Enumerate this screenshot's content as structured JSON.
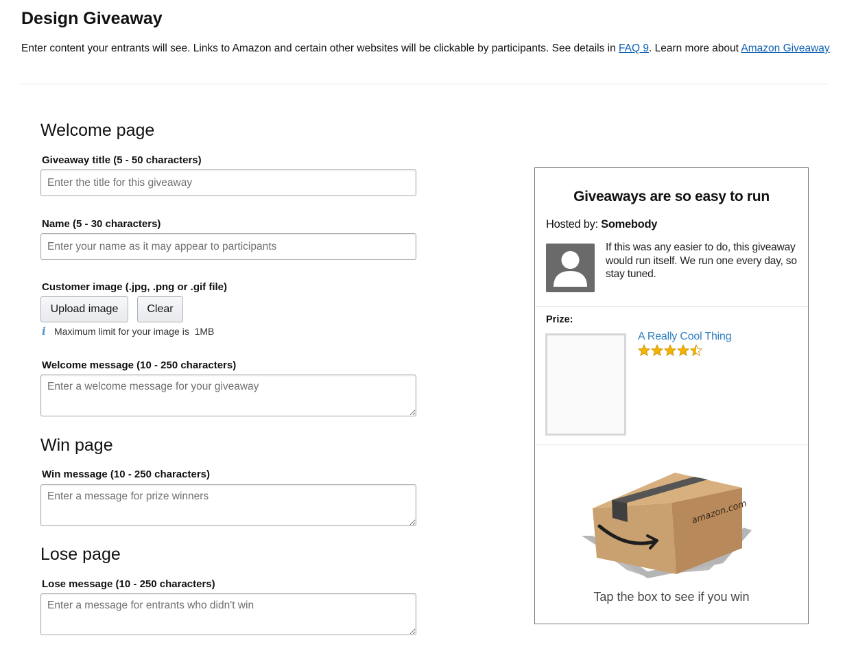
{
  "header": {
    "title": "Design Giveaway",
    "intro_text": "Enter content your entrants will see. Links to Amazon and certain other websites will be clickable by participants. See details in ",
    "faq_link": "FAQ 9",
    "intro_text_2": ". Learn more about ",
    "learn_link": "Amazon Giveaway"
  },
  "welcome_section": {
    "heading": "Welcome page",
    "title_field": {
      "label": "Giveaway title (5 - 50 characters)",
      "placeholder": "Enter the title for this giveaway",
      "value": ""
    },
    "name_field": {
      "label": "Name (5 - 30 characters)",
      "placeholder": "Enter your name as it may appear to participants",
      "value": ""
    },
    "image_field": {
      "label": "Customer image (.jpg, .png or .gif file)",
      "upload_button": "Upload image",
      "clear_button": "Clear",
      "hint": "Maximum limit for your image is  1MB"
    },
    "message_field": {
      "label": "Welcome message (10 - 250 characters)",
      "placeholder": "Enter a welcome message for your giveaway",
      "value": ""
    }
  },
  "win_section": {
    "heading": "Win page",
    "message_field": {
      "label": "Win message (10 - 250 characters)",
      "placeholder": "Enter a message for prize winners",
      "value": ""
    }
  },
  "lose_section": {
    "heading": "Lose page",
    "message_field": {
      "label": "Lose message (10 - 250 characters)",
      "placeholder": "Enter a message for entrants who didn't win",
      "value": ""
    }
  },
  "preview": {
    "title": "Giveaways are so easy to run",
    "hosted_label": "Hosted by: ",
    "host_name": "Somebody",
    "description": "If this was any easier to do, this giveaway would run itself. We run one every day, so stay tuned.",
    "prize_label": "Prize:",
    "prize_name": "A Really Cool Thing",
    "prize_rating": 4.5,
    "box_brand": "amazon.com",
    "tap_text": "Tap the box to see if you win"
  },
  "colors": {
    "link": "#0b5fb3",
    "prize_link": "#2f7fc1",
    "star": "#f4b400",
    "box_tan": "#c39a6b",
    "tape": "#555555"
  },
  "icons": {
    "info": "info-icon",
    "avatar": "user-silhouette-icon",
    "star": "star-icon",
    "box": "amazon-box-icon"
  }
}
